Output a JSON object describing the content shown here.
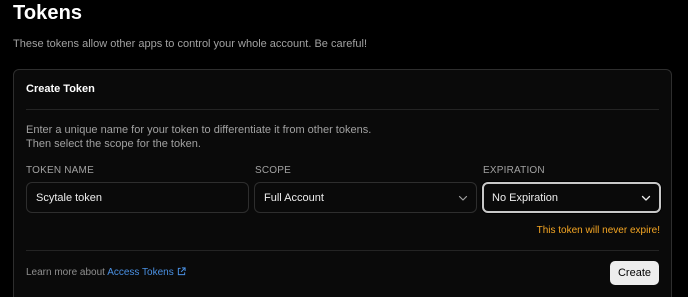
{
  "page": {
    "title": "Tokens",
    "subtitle": "These tokens allow other apps to control your whole account. Be careful!"
  },
  "card": {
    "title": "Create Token",
    "description_line1": "Enter a unique name for your token to differentiate it from other tokens.",
    "description_line2": "Then select the scope for the token.",
    "fields": {
      "name": {
        "label": "TOKEN NAME",
        "value": "Scytale token"
      },
      "scope": {
        "label": "SCOPE",
        "value": "Full Account"
      },
      "expiration": {
        "label": "EXPIRATION",
        "value": "No Expiration"
      }
    },
    "warning": "This token will never expire!",
    "footer": {
      "prefix": "Learn more about",
      "link_label": "Access Tokens",
      "link_icon": "external-link-icon"
    },
    "create_label": "Create"
  },
  "colors": {
    "background": "#000000",
    "card": "#0a0a0a",
    "border": "#2e2e2e",
    "warning": "#f5a623",
    "link": "#4a90e2",
    "button": "#ededed"
  }
}
